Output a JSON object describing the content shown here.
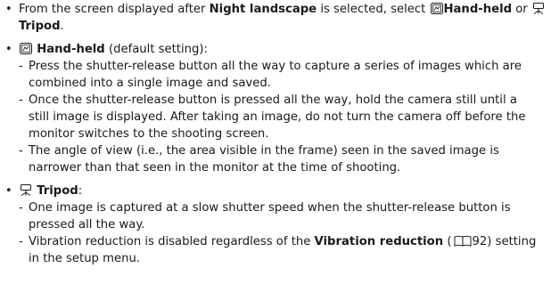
{
  "items": [
    {
      "intro": "From the screen displayed after",
      "term1": "Night landscape",
      "mid1": "is selected, select",
      "term2": "Hand-held",
      "mid2": "or",
      "term3": "Tripod",
      "end": "."
    },
    {
      "term": "Hand-held",
      "suffix": "(default setting):",
      "subs": [
        "Press the shutter-release button all the way to capture a series of images which are combined into a single image and saved.",
        "Once the shutter-release button is pressed all the way, hold the camera still until a still image is displayed. After taking an image, do not turn the camera off before the monitor switches to the shooting screen.",
        "The angle of view (i.e., the area visible in the frame) seen in the saved image is narrower than that seen in the monitor at the time of shooting."
      ]
    },
    {
      "term": "Tripod",
      "suffix": ":",
      "subs": [
        "One image is captured at a slow shutter speed when the shutter-release button is pressed all the way."
      ],
      "vr_pre": "Vibration reduction is disabled regardless of the",
      "vr_term": "Vibration reduction",
      "vr_page": "92",
      "vr_post": "setting in the setup menu."
    }
  ],
  "bullet_char": "•",
  "dash_char": "-",
  "icons": {
    "handheld": "handheld-mode-icon",
    "tripod": "tripod-mode-icon",
    "reference": "book-reference-icon"
  }
}
